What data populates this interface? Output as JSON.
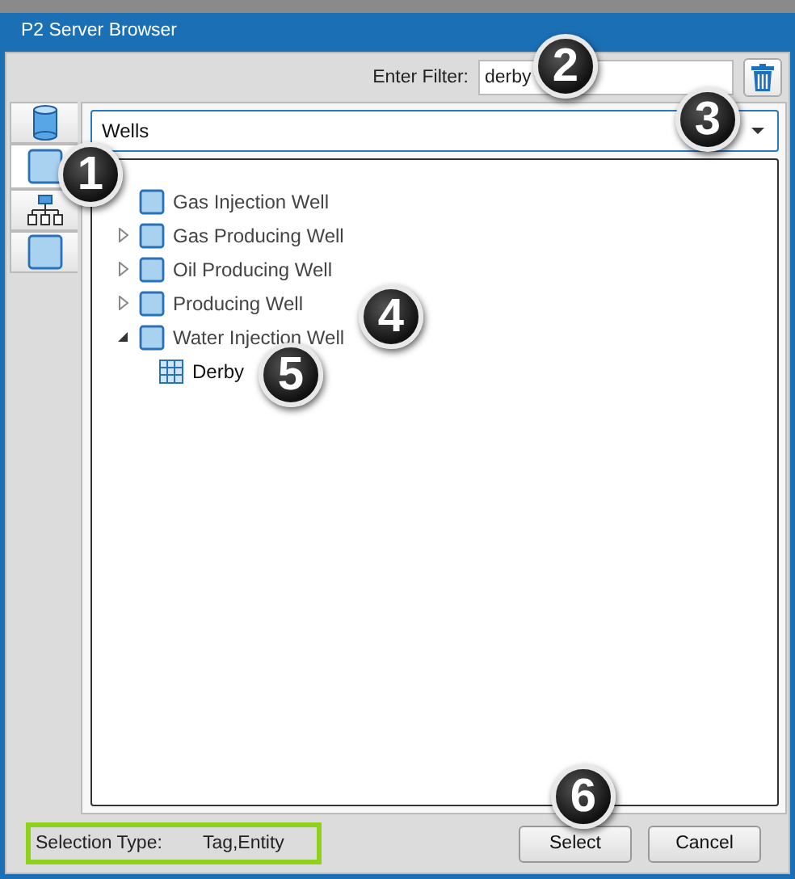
{
  "window": {
    "title": "P2 Server Browser"
  },
  "filter": {
    "label": "Enter Filter:",
    "value": "derby"
  },
  "side_tabs": [
    {
      "kind": "database",
      "selected": false
    },
    {
      "kind": "square",
      "selected": true
    },
    {
      "kind": "hierarchy",
      "selected": false
    },
    {
      "kind": "square",
      "selected": false
    }
  ],
  "dropdown": {
    "value": "Wells"
  },
  "tree": [
    {
      "label": "Gas Injection Well",
      "has_children": false,
      "kind": "class"
    },
    {
      "label": "Gas Producing Well",
      "has_children": true,
      "expanded": false,
      "kind": "class"
    },
    {
      "label": "Oil Producing Well",
      "has_children": true,
      "expanded": false,
      "kind": "class"
    },
    {
      "label": "Producing Well",
      "has_children": true,
      "expanded": false,
      "kind": "class"
    },
    {
      "label": "Water Injection Well",
      "has_children": true,
      "expanded": true,
      "kind": "class",
      "children": [
        {
          "label": "Derby",
          "has_children": false,
          "kind": "table"
        }
      ]
    }
  ],
  "status": {
    "label": "Selection Type:",
    "value": "Tag,Entity"
  },
  "buttons": [
    "Select",
    "Cancel"
  ],
  "callouts": [
    "1",
    "2",
    "3",
    "4",
    "5",
    "6"
  ]
}
